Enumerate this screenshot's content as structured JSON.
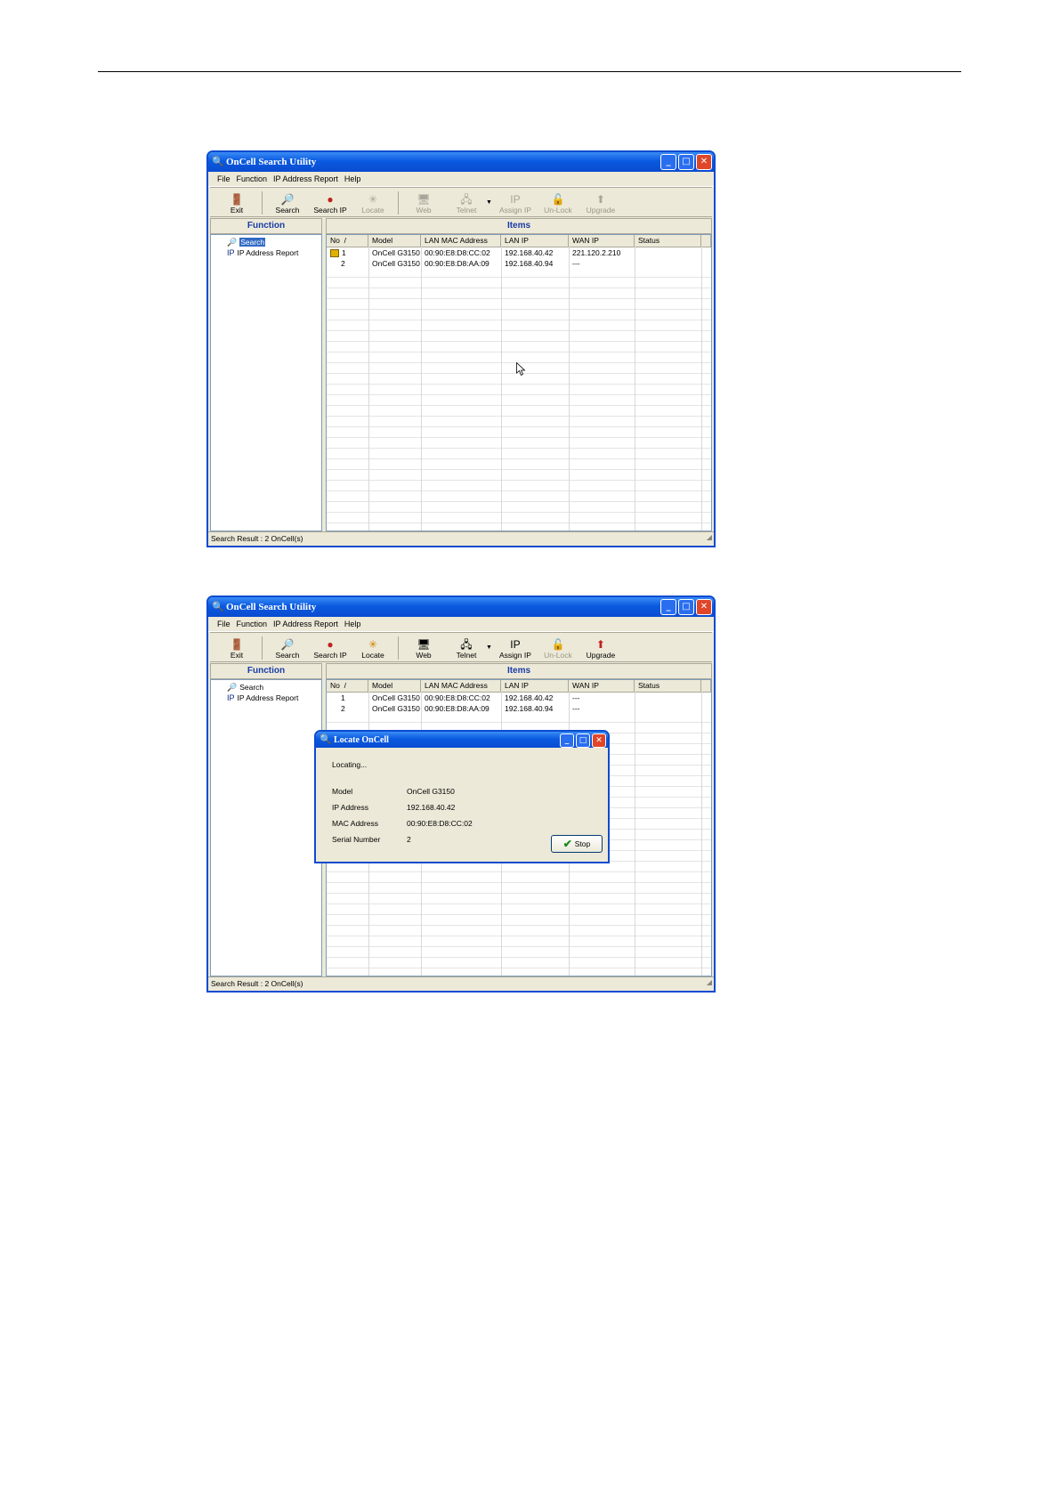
{
  "window_title": "OnCell Search Utility",
  "menu": [
    "File",
    "Function",
    "IP Address Report",
    "Help"
  ],
  "toolbar": [
    {
      "label": "Exit",
      "icon": "exit-icon"
    },
    {
      "label": "Search",
      "icon": "search-icon"
    },
    {
      "label": "Search IP",
      "icon": "search-ip-icon"
    },
    {
      "label": "Locate",
      "icon": "locate-icon"
    },
    {
      "label": "Web",
      "icon": "web-icon"
    },
    {
      "label": "Telnet",
      "icon": "telnet-icon"
    },
    {
      "label": "Assign IP",
      "icon": "assign-ip-icon"
    },
    {
      "label": "Un-Lock",
      "icon": "unlock-icon"
    },
    {
      "label": "Upgrade",
      "icon": "upgrade-icon"
    }
  ],
  "function_pane": {
    "title": "Function",
    "items": [
      "Search",
      "IP Address Report"
    ]
  },
  "items_pane": {
    "title": "Items"
  },
  "columns": [
    "No",
    "Model",
    "LAN MAC Address",
    "LAN IP",
    "WAN IP",
    "Status"
  ],
  "sort_indicator": "/",
  "rows": [
    {
      "no": "1",
      "model": "OnCell G3150",
      "mac": "00:90:E8:D8:CC:02",
      "lan_ip": "192.168.40.42",
      "wan_ip_1": "221.120.2.210",
      "wan_ip_2": "---",
      "status": ""
    },
    {
      "no": "2",
      "model": "OnCell G3150",
      "mac": "00:90:E8:D8:AA:09",
      "lan_ip": "192.168.40.94",
      "wan_ip_1": "---",
      "wan_ip_2": "---",
      "status": ""
    }
  ],
  "status_bar": "Search Result : 2 OnCell(s)",
  "dialog": {
    "title": "Locate OnCell",
    "status": "Locating...",
    "fields": [
      {
        "label": "Model",
        "value": "OnCell G3150"
      },
      {
        "label": "IP Address",
        "value": "192.168.40.42"
      },
      {
        "label": "MAC Address",
        "value": "00:90:E8:D8:CC:02"
      },
      {
        "label": "Serial Number",
        "value": "2"
      }
    ],
    "stop_label": "Stop"
  }
}
